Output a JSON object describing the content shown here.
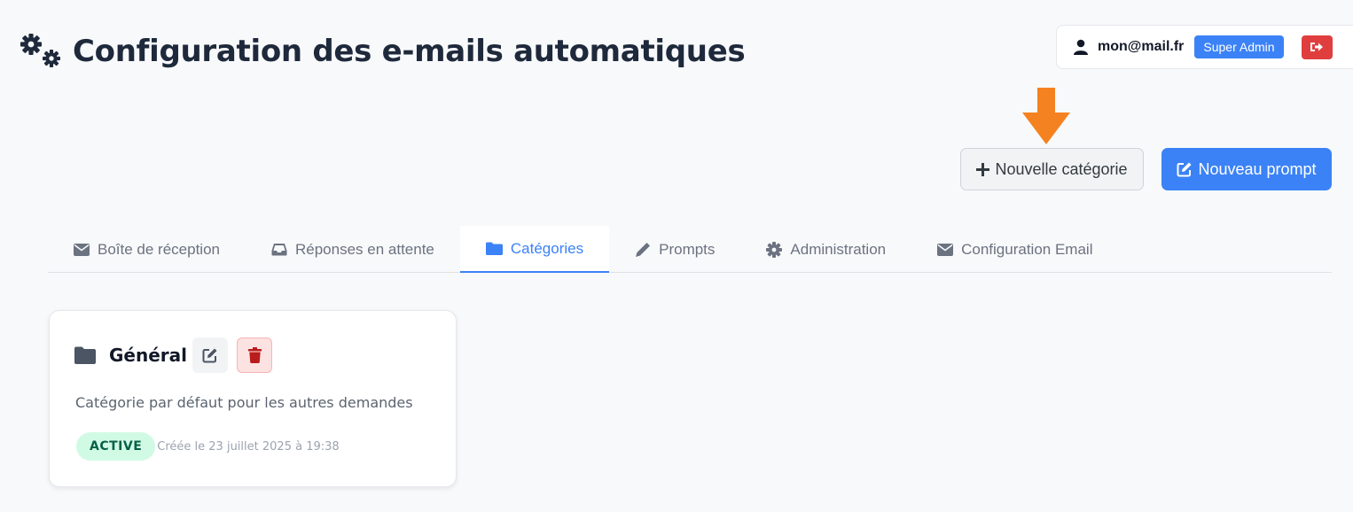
{
  "header": {
    "title": "Configuration des e-mails automatiques",
    "icon": "gears-icon"
  },
  "user": {
    "email": "mon@mail.fr",
    "role": "Super Admin",
    "logout_icon": "sign-out-icon"
  },
  "actions": {
    "new_category": "Nouvelle catégorie",
    "new_prompt": "Nouveau prompt"
  },
  "tabs": [
    {
      "label": "Boîte de réception",
      "icon": "envelope-icon",
      "active": false
    },
    {
      "label": "Réponses en attente",
      "icon": "inbox-icon",
      "active": false
    },
    {
      "label": "Catégories",
      "icon": "folder-icon",
      "active": true
    },
    {
      "label": "Prompts",
      "icon": "pencil-icon",
      "active": false
    },
    {
      "label": "Administration",
      "icon": "gear-icon",
      "active": false
    },
    {
      "label": "Configuration Email",
      "icon": "envelope-icon",
      "active": false
    }
  ],
  "categories": [
    {
      "name": "Général",
      "description": "Catégorie par défaut pour les autres demandes",
      "status": "ACTIVE",
      "created": "Créée le 23 juillet 2025 à 19:38"
    }
  ],
  "colors": {
    "primary": "#3b82f6",
    "danger": "#e03e3e",
    "annotation_arrow": "#f58220",
    "status_active_bg": "#d1fae5",
    "status_active_text": "#065f46"
  }
}
